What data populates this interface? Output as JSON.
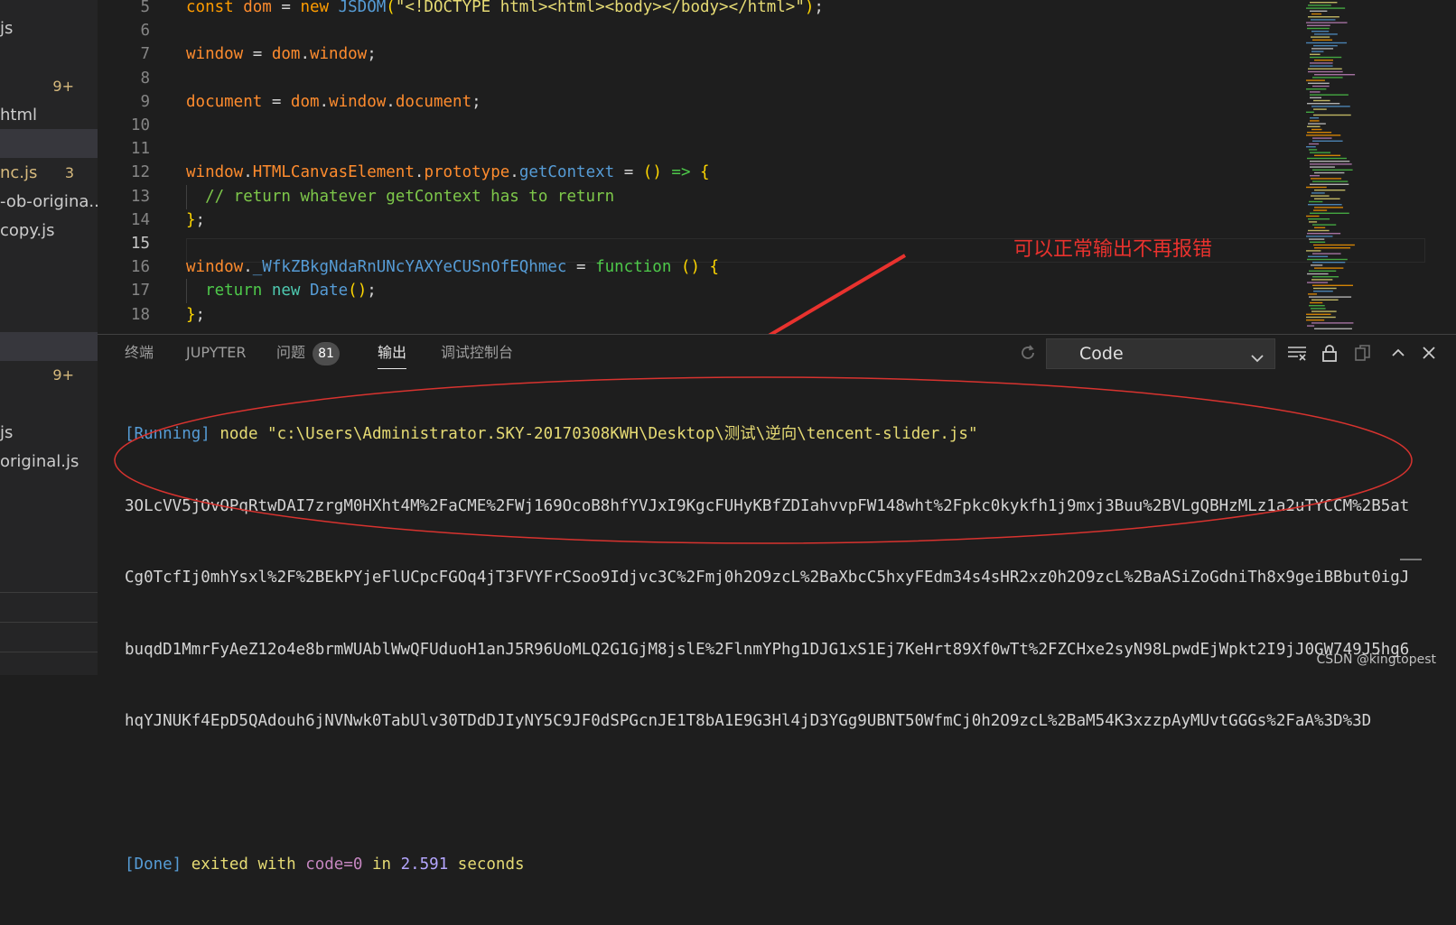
{
  "sidebar": {
    "items": [
      {
        "name": "js",
        "badge": ""
      },
      {
        "name": "",
        "badge": "9+"
      },
      {
        "name": "html",
        "badge": ""
      },
      {
        "name": "nc.js",
        "badge": "3"
      },
      {
        "name": "-ob-origina...",
        "badge": ""
      },
      {
        "name": "copy.js",
        "badge": ""
      },
      {
        "name": "",
        "badge": "9+"
      },
      {
        "name": "js",
        "badge": ""
      },
      {
        "name": "original.js",
        "badge": ""
      }
    ]
  },
  "editor": {
    "lines": [
      {
        "n": "5",
        "t": [
          [
            "kw",
            "const "
          ],
          [
            "id",
            "dom"
          ],
          [
            "op",
            " = "
          ],
          [
            "kw",
            "new "
          ],
          [
            "fn",
            "JSDOM"
          ],
          [
            "pn",
            "("
          ],
          [
            "str",
            "\"<!DOCTYPE html><html><body></body></html>\""
          ],
          [
            "pn",
            ")"
          ],
          [
            "op",
            ";"
          ]
        ]
      },
      {
        "n": "6",
        "t": []
      },
      {
        "n": "7",
        "t": [
          [
            "id",
            "window"
          ],
          [
            "op",
            " = "
          ],
          [
            "id",
            "dom"
          ],
          [
            "op",
            "."
          ],
          [
            "id",
            "window"
          ],
          [
            "op",
            ";"
          ]
        ]
      },
      {
        "n": "8",
        "t": []
      },
      {
        "n": "9",
        "t": [
          [
            "id",
            "document"
          ],
          [
            "op",
            " = "
          ],
          [
            "id",
            "dom"
          ],
          [
            "op",
            "."
          ],
          [
            "id",
            "window"
          ],
          [
            "op",
            "."
          ],
          [
            "id",
            "document"
          ],
          [
            "op",
            ";"
          ]
        ]
      },
      {
        "n": "10",
        "t": []
      },
      {
        "n": "11",
        "t": []
      },
      {
        "n": "12",
        "t": [
          [
            "id",
            "window"
          ],
          [
            "op",
            "."
          ],
          [
            "id",
            "HTMLCanvasElement"
          ],
          [
            "op",
            "."
          ],
          [
            "id",
            "prototype"
          ],
          [
            "op",
            "."
          ],
          [
            "fn",
            "getContext"
          ],
          [
            "op",
            " = "
          ],
          [
            "pn",
            "()"
          ],
          [
            "op",
            " "
          ],
          [
            "gn",
            "=>"
          ],
          [
            "op",
            " "
          ],
          [
            "pn",
            "{"
          ]
        ]
      },
      {
        "n": "13",
        "t": [
          [
            "op",
            "  "
          ],
          [
            "cm",
            "// return whatever getContext has to return"
          ]
        ]
      },
      {
        "n": "14",
        "t": [
          [
            "pn",
            "}"
          ],
          [
            "op",
            ";"
          ]
        ]
      },
      {
        "n": "15",
        "t": []
      },
      {
        "n": "16",
        "t": [
          [
            "id",
            "window"
          ],
          [
            "op",
            "."
          ],
          [
            "fn",
            "_WfkZBkgNdaRnUNcYAXYeCUSnOfEQhmec"
          ],
          [
            "op",
            " = "
          ],
          [
            "gn",
            "function"
          ],
          [
            "op",
            " "
          ],
          [
            "pn",
            "()"
          ],
          [
            "op",
            " "
          ],
          [
            "pn",
            "{"
          ]
        ]
      },
      {
        "n": "17",
        "t": [
          [
            "op",
            "  "
          ],
          [
            "gn",
            "return "
          ],
          [
            "kwg",
            "new "
          ],
          [
            "fn",
            "Date"
          ],
          [
            "pn",
            "()"
          ],
          [
            "op",
            ";"
          ]
        ]
      },
      {
        "n": "18",
        "t": [
          [
            "pn",
            "}"
          ],
          [
            "op",
            ";"
          ]
        ]
      }
    ],
    "annotation": "可以正常输出不再报错"
  },
  "panel": {
    "tabs": [
      {
        "label": "终端"
      },
      {
        "label": "JUPYTER"
      },
      {
        "label": "问题"
      },
      {
        "label": "输出"
      },
      {
        "label": "调试控制台"
      }
    ],
    "problems_count": "81",
    "select_value": "Code",
    "output": {
      "running_tag": "[Running]",
      "command": " node \"c:\\Users\\Administrator.SKY-20170308KWH\\Desktop\\测试\\逆向\\tencent-slider.js\"",
      "data_lines": [
        "3OLcVV5jOvOPqRtwDAI7zrgM0HXht4M%2FaCME%2FWj169OcoB8hfYVJxI9KgcFUHyKBfZDIahvvpFW148wht%2Fpkc0kykfh1j9mxj3Buu%2BVLgQBHzMLz1a2uTYCCM%2B5at",
        "Cg0TcfIj0mhYsxl%2F%2BEkPYjeFlUCpcFGOq4jT3FVYFrCSoo9Idjvc3C%2Fmj0h2O9zcL%2BaXbcC5hxyFEdm34s4sHR2xz0h2O9zcL%2BaASiZoGdniTh8x9geiBBbut0igJ",
        "buqdD1MmrFyAeZ12o4e8brmWUAblWwQFUduoH1anJ5R96UoMLQ2G1GjM8jslE%2FlnmYPhg1DJG1xS1Ej7KeHrt89Xf0wTt%2FZCHxe2syN98LpwdEjWpkt2I9jJ0GW749J5hg6",
        "hqYJNUKf4EpD5QAdouh6jNVNwk0TabUlv30TDdDJIyNY5C9JF0dSPGcnJE1T8bA1E9G3Hl4jD3YGg9UBNT50WfmCj0h2O9zcL%2BaM54K3xzzpAyMUvtGGGs%2FaA%3D%3D"
      ],
      "done_tag": "[Done]",
      "exit_text": " exited with ",
      "code_text": "code=0",
      "in_text": " in ",
      "seconds_value": "2.591",
      "seconds_text": " seconds"
    }
  },
  "watermark": "CSDN @kingtopest",
  "icons": [
    "refresh-icon",
    "chevron-down-icon",
    "clear-output-icon",
    "lock-icon",
    "copy-icon",
    "chevron-up-icon",
    "close-icon"
  ]
}
